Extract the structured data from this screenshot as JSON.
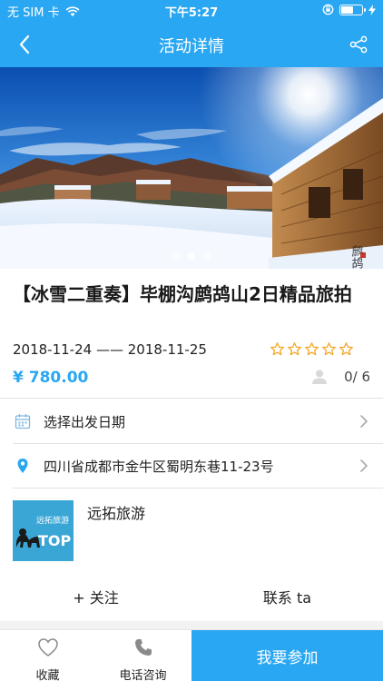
{
  "status_bar": {
    "carrier": "无 SIM 卡",
    "time": "下午5:27",
    "battery_level": 0.6
  },
  "nav": {
    "title": "活动详情",
    "back_icon": "chevron-left-icon",
    "share_icon": "share-icon"
  },
  "hero": {
    "carousel_total": 3,
    "carousel_active": 2
  },
  "event": {
    "title": "【冰雪二重奏】毕棚沟鹧鸪山2日精品旅拍",
    "date_start": "2018-11-24",
    "date_sep": "——",
    "date_end": "2018-11-25",
    "rating_stars": 0,
    "rating_max": 5,
    "price": "¥ 780.00",
    "participants": "0/ 6"
  },
  "rows": {
    "date_select": {
      "label": "选择出发日期",
      "icon": "calendar-icon"
    },
    "address": {
      "label": "四川省成都市金牛区蜀明东巷11-23号",
      "icon": "location-pin-icon"
    }
  },
  "organizer": {
    "name": "远拓旅游",
    "logo_text_top": "远拓旅游",
    "logo_text_bottom": "TOP"
  },
  "actions": {
    "follow": "+ 关注",
    "contact": "联系 ta"
  },
  "tabbar": {
    "favorite": "收藏",
    "phone": "电话咨询",
    "join": "我要参加"
  },
  "colors": {
    "brand": "#2aa7f2",
    "star": "#f5a623"
  }
}
